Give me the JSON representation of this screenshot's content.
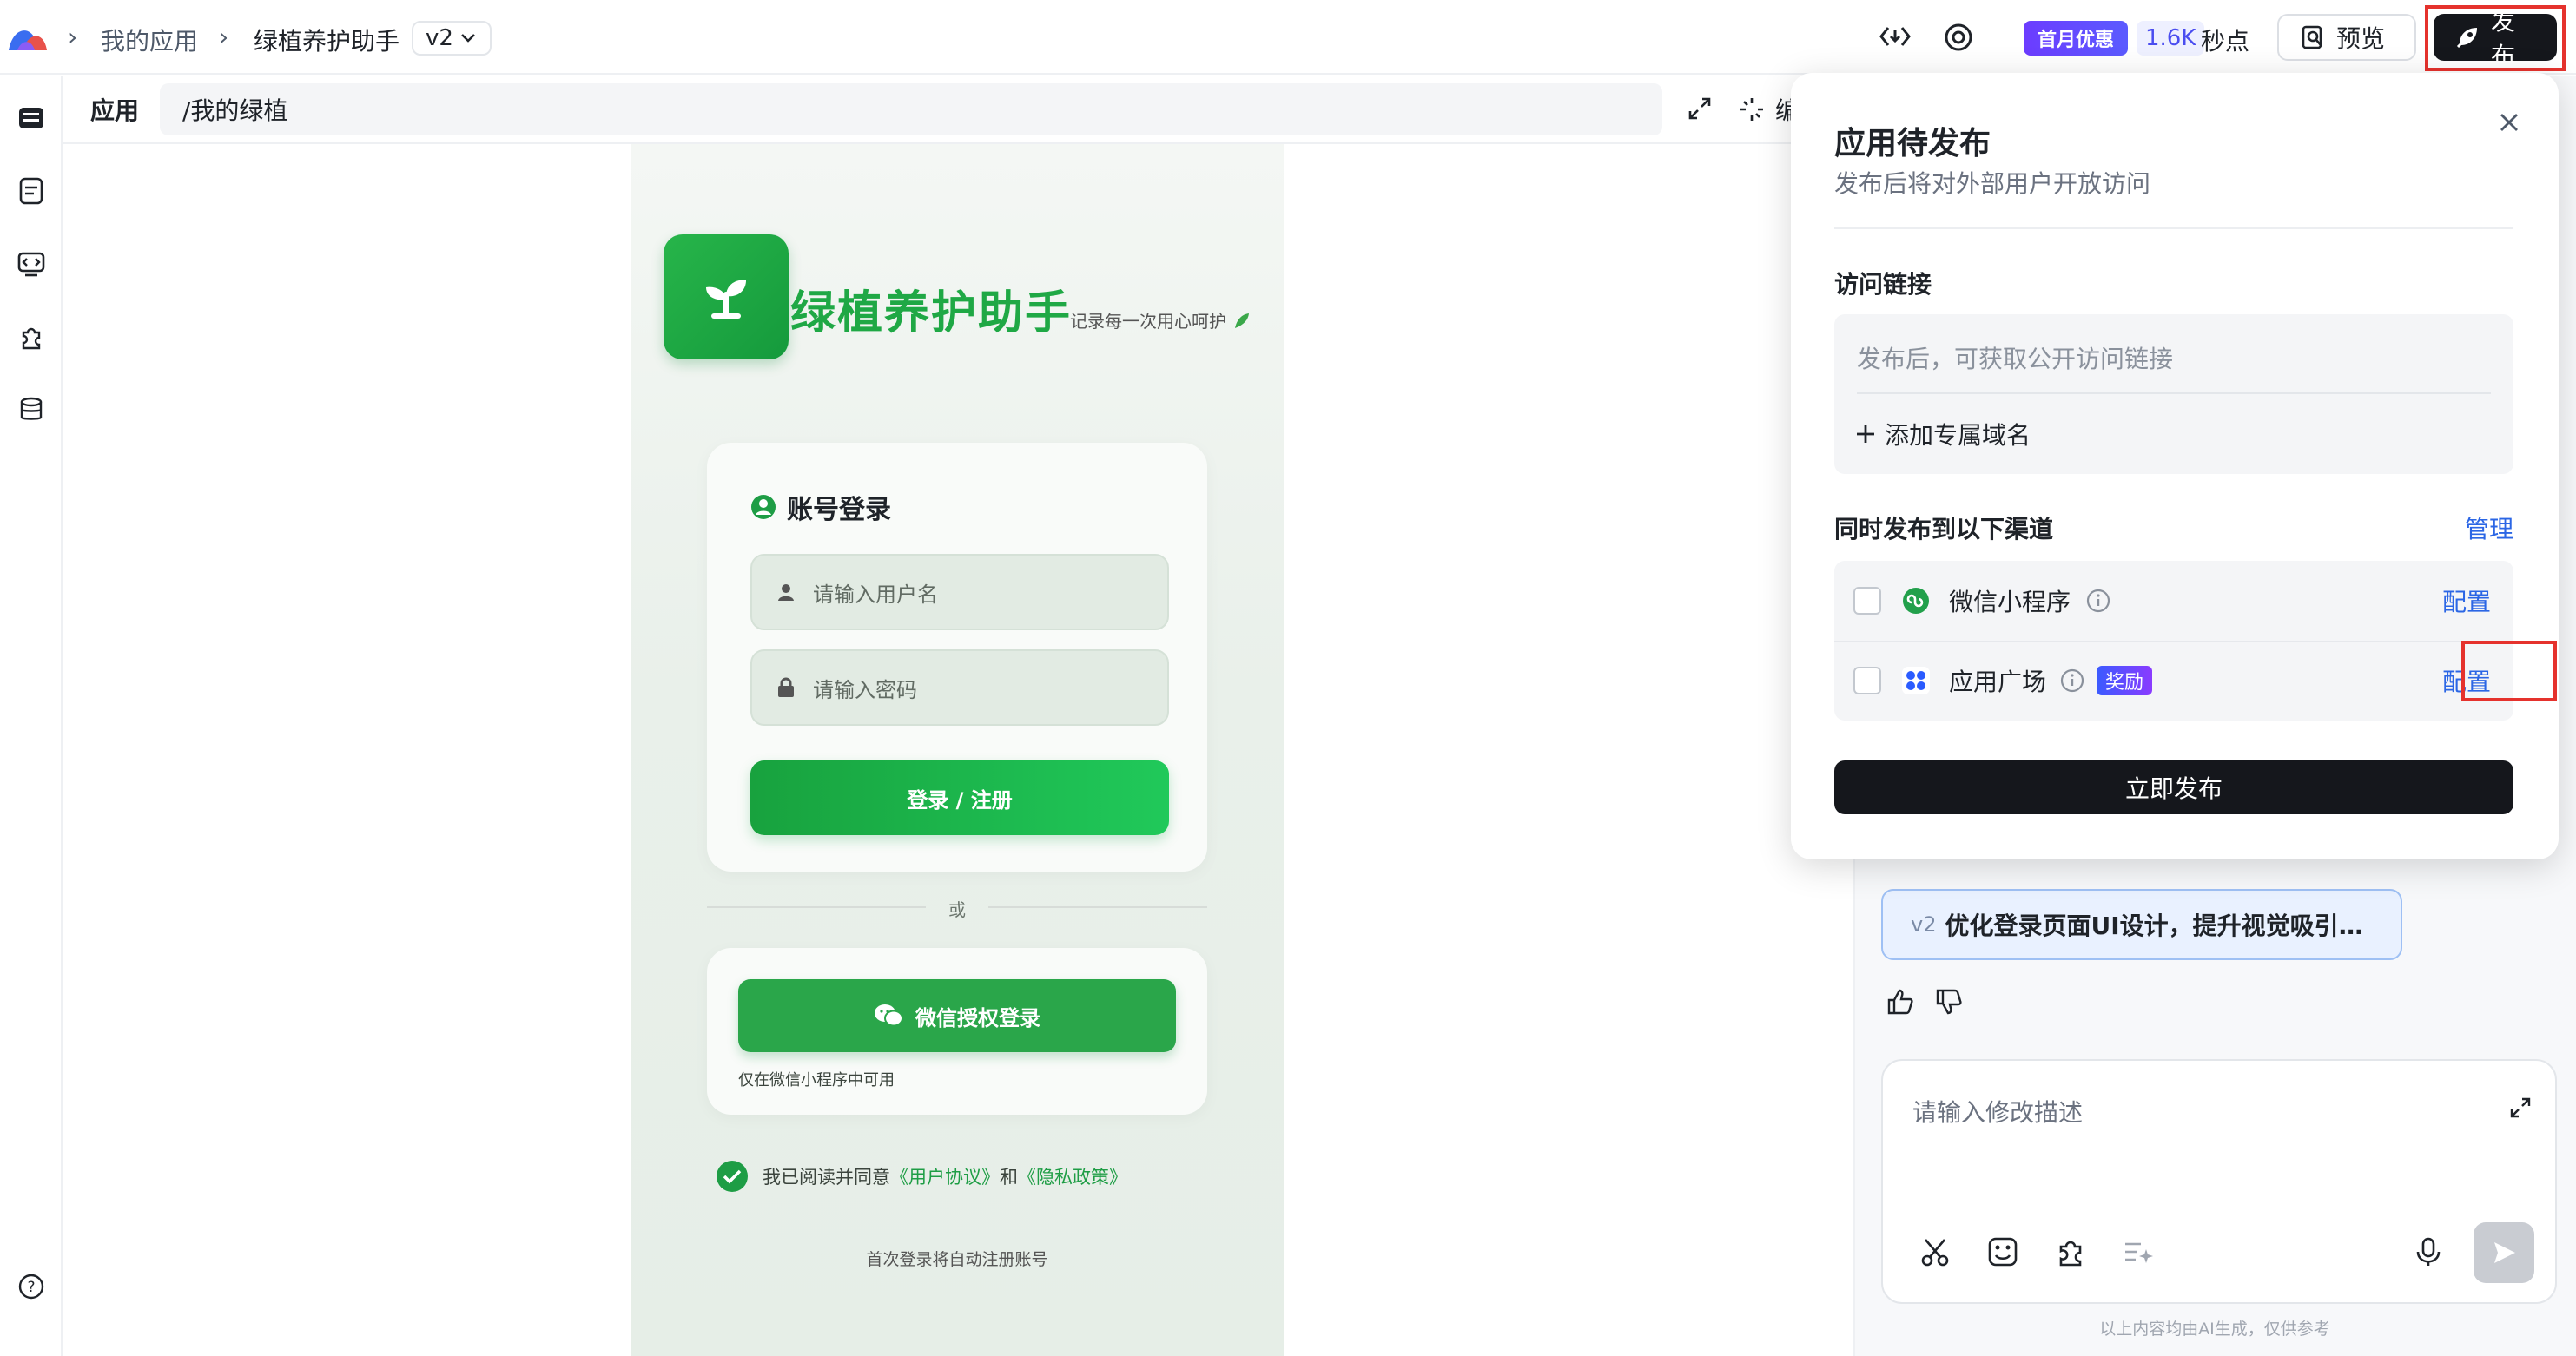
{
  "header": {
    "breadcrumb": {
      "my_apps": "我的应用",
      "app_name": "绿植养护助手"
    },
    "version_select": "v2",
    "promo_badge": "首月优惠",
    "credits": "1.6K",
    "credits_unit": "秒点",
    "preview_label": "预览",
    "publish_label": "发布"
  },
  "sidebar": {
    "icons": [
      "app-icon",
      "document-icon",
      "code-icon",
      "plugin-icon",
      "database-icon",
      "help-icon"
    ]
  },
  "canvas": {
    "tab_label": "应用",
    "path": "/我的绿植",
    "edit_label_fragment": "编"
  },
  "preview": {
    "app_title": "绿植养护助手",
    "app_subtitle": "记录每一次用心呵护",
    "login_card_title": "账号登录",
    "username_placeholder": "请输入用户名",
    "password_placeholder": "请输入密码",
    "login_button": "登录 / 注册",
    "or_text": "或",
    "wechat_button": "微信授权登录",
    "wechat_note": "仅在微信小程序中可用",
    "agreement": {
      "prefix": "我已阅读并同意",
      "user_agreement": "《用户协议》",
      "and": "和",
      "privacy_policy": "《隐私政策》"
    },
    "auto_register_note": "首次登录将自动注册账号"
  },
  "publish_popover": {
    "title": "应用待发布",
    "subtitle": "发布后将对外部用户开放访问",
    "access_link_label": "访问链接",
    "access_link_placeholder": "发布后，可获取公开访问链接",
    "add_domain": "添加专属域名",
    "channels_label": "同时发布到以下渠道",
    "manage": "管理",
    "channels": [
      {
        "name": "微信小程序",
        "config": "配置",
        "badge": ""
      },
      {
        "name": "应用广场",
        "config": "配置",
        "badge": "奖励"
      }
    ],
    "publish_now": "立即发布"
  },
  "chat": {
    "version_tag": "v2",
    "version_message": "优化登录页面UI设计，提升视觉吸引…",
    "input_placeholder": "请输入修改描述",
    "disclaimer": "以上内容均由AI生成，仅供参考"
  },
  "colors": {
    "brand_green": "#1fa845",
    "link_blue": "#2b66e5",
    "highlight_red": "#e5322d",
    "primary_dark": "#15171c"
  }
}
